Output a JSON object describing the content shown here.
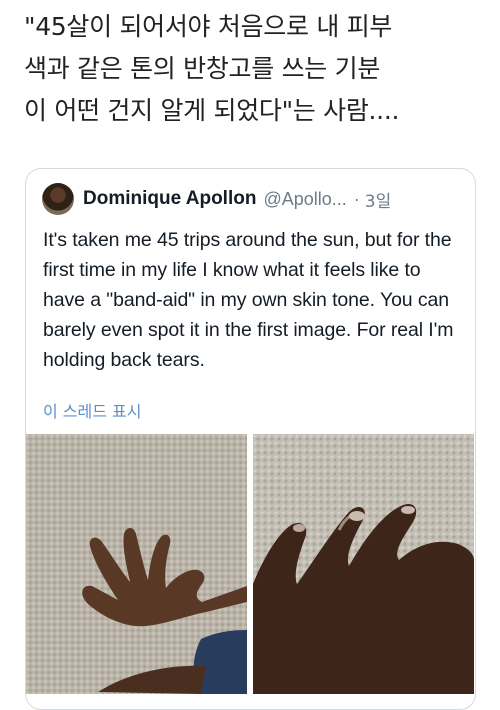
{
  "post": {
    "headline": "\"45살이 되어서야 처음으로 내 피부\n색과 같은 톤의 반창고를 쓰는 기분\n이 어떤 건지 알게 되었다\"는 사람...."
  },
  "tweet": {
    "author_name": "Dominique Apollon",
    "handle": "@Apollo...",
    "separator": "·",
    "time": "3일",
    "text": "It's taken me 45 trips around the sun, but for the first time in my life I know what it feels like to have a \"band-aid\" in my own skin tone. You can barely even spot it in the first image. For real I'm holding back tears.",
    "thread_link": "이 스레드 표시",
    "media": [
      {
        "icon": "photo-hand-on-carpet"
      },
      {
        "icon": "photo-hand-closeup"
      }
    ]
  },
  "colors": {
    "link": "#5b8fc9",
    "handle_gray": "#6b7b8a",
    "card_border": "#d4dbe2"
  }
}
